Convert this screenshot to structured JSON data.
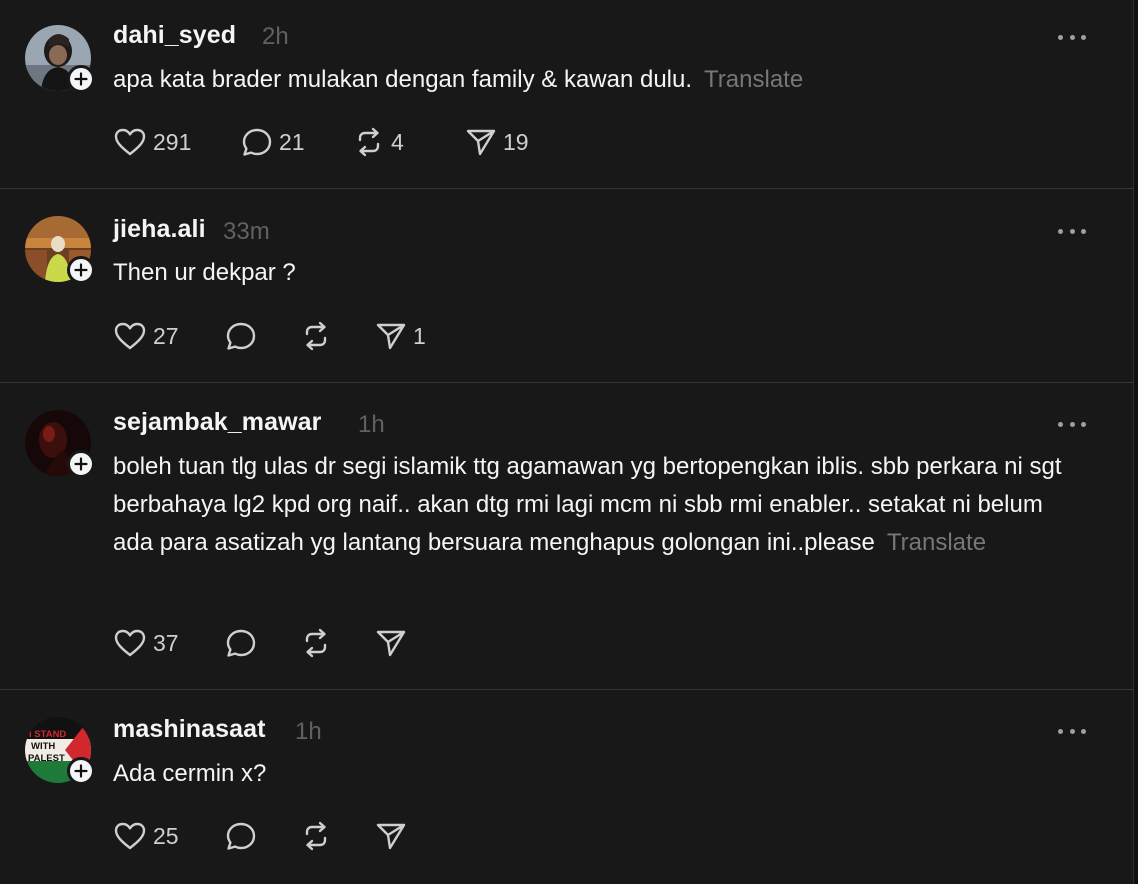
{
  "posts": [
    {
      "username": "dahi_syed",
      "time": "2h",
      "text": "apa kata brader mulakan dengan family & kawan dulu.",
      "translate": "Translate",
      "likes": "291",
      "replies": "21",
      "reposts": "4",
      "shares": "19"
    },
    {
      "username": "jieha.ali",
      "time": "33m",
      "text": "Then ur dekpar ?",
      "translate": "",
      "likes": "27",
      "replies": "",
      "reposts": "",
      "shares": "1"
    },
    {
      "username": "sejambak_mawar",
      "time": "1h",
      "text": "boleh tuan tlg ulas dr segi islamik ttg agamawan yg bertopengkan iblis. sbb perkara ni sgt berbahaya lg2 kpd org naif.. akan dtg rmi lagi mcm ni sbb rmi enabler.. setakat ni belum ada para asatizah yg lantang bersuara menghapus golongan ini..please",
      "translate": "Translate",
      "likes": "37",
      "replies": "",
      "reposts": "",
      "shares": ""
    },
    {
      "username": "mashinasaat",
      "time": "1h",
      "text": "Ada cermin x?",
      "translate": "",
      "likes": "25",
      "replies": "",
      "reposts": "",
      "shares": "",
      "avatar_text": [
        "I STAND",
        "WITH",
        "PALEST"
      ]
    }
  ],
  "icons": {
    "like": "heart-icon",
    "reply": "comment-icon",
    "repost": "repost-icon",
    "share": "send-icon",
    "more": "more-icon",
    "follow": "plus-icon"
  },
  "colors": {
    "background": "#181818",
    "text": "#f3f5f7",
    "muted": "#616161",
    "translate": "#777777",
    "divider": "#333638"
  }
}
